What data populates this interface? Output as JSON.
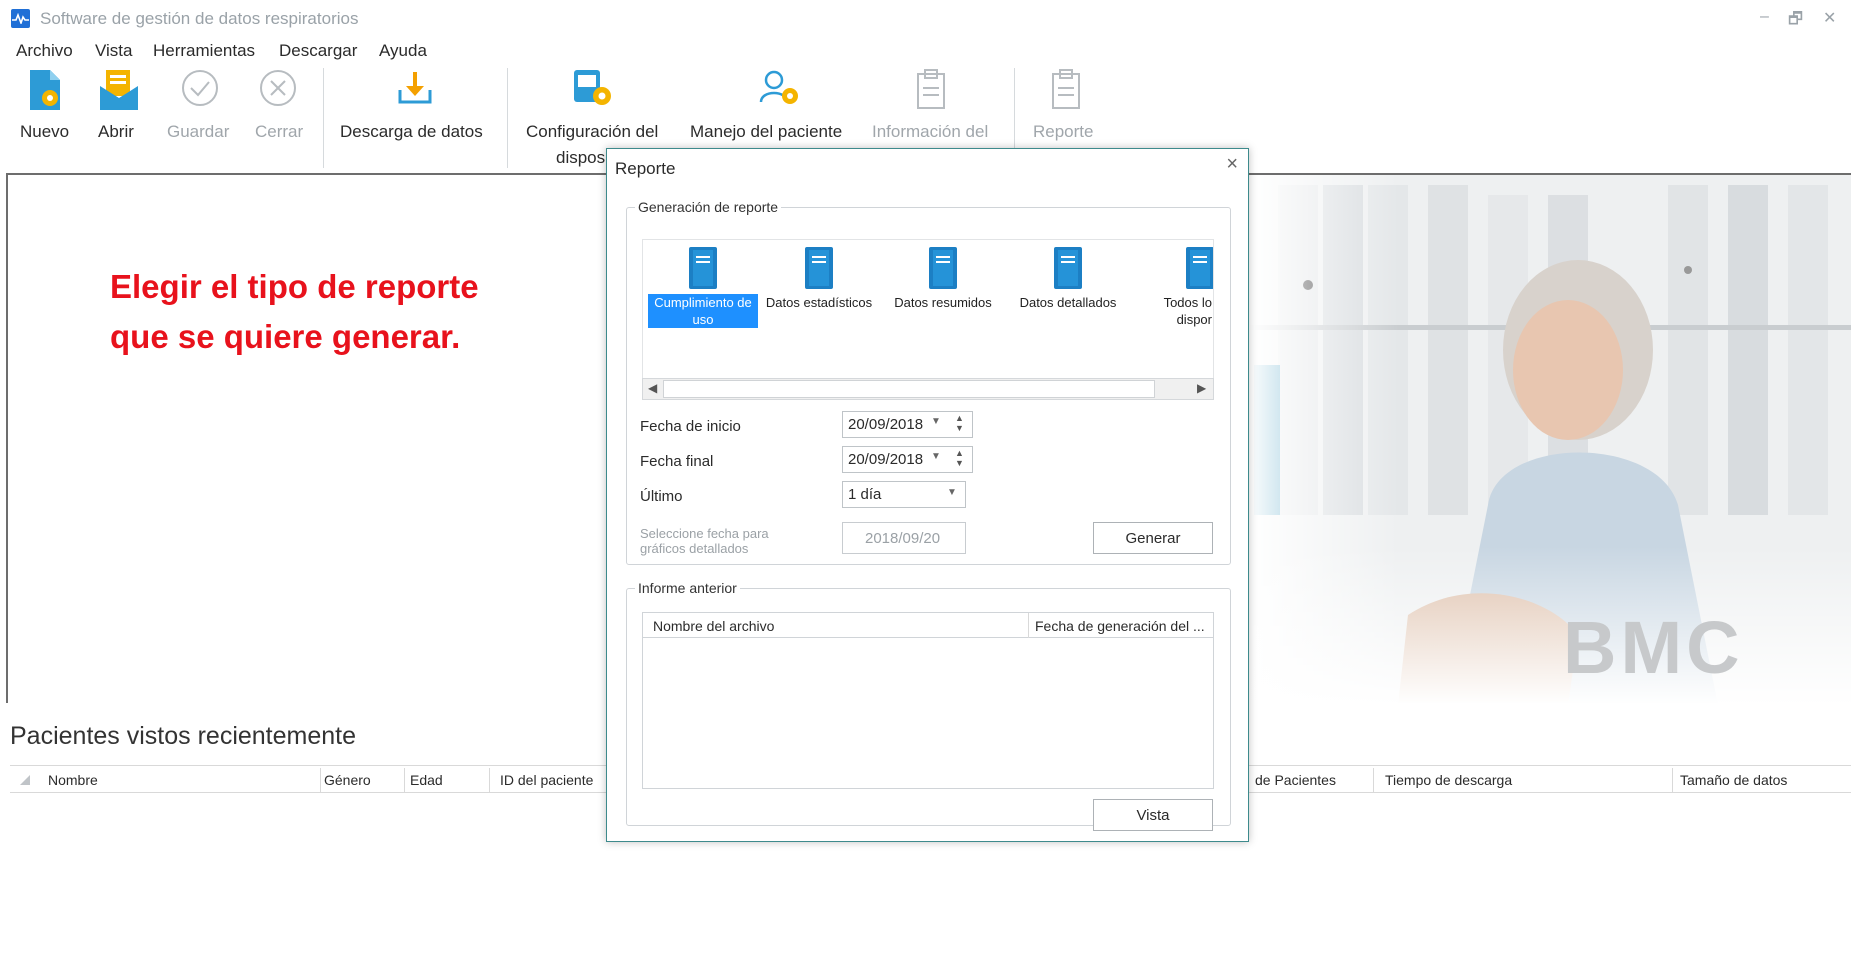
{
  "window": {
    "title": "Software de gestión de datos respiratorios",
    "minimize": "–",
    "restore": "🗗",
    "close": "✕"
  },
  "menu": [
    "Archivo",
    "Vista",
    "Herramientas",
    "Descargar",
    "Ayuda"
  ],
  "toolbar": {
    "nuevo": "Nuevo",
    "abrir": "Abrir",
    "guardar": "Guardar",
    "cerrar": "Cerrar",
    "descarga": "Descarga de datos",
    "config_line1": "Configuración del",
    "config_line2": "dispos",
    "manejo": "Manejo del paciente",
    "informacion": "Información del",
    "reporte": "Reporte"
  },
  "instruction": {
    "line1": "Elegir el tipo de reporte",
    "line2": "que se quiere generar."
  },
  "logo": "BMC",
  "recent": {
    "title": "Pacientes vistos recientemente",
    "columns": [
      "Nombre",
      "Género",
      "Edad",
      "ID del paciente",
      "de Pacientes",
      "Tiempo de descarga",
      "Tamaño de datos"
    ]
  },
  "dialog": {
    "title": "Reporte",
    "close": "×",
    "generation_group": "Generación de reporte",
    "report_types": [
      {
        "label": "Cumplimiento de uso",
        "selected": true
      },
      {
        "label": "Datos estadísticos",
        "selected": false
      },
      {
        "label": "Datos resumidos",
        "selected": false
      },
      {
        "label": "Datos detallados",
        "selected": false
      },
      {
        "label": "Todos lo dispor",
        "selected": false
      }
    ],
    "fecha_inicio_label": "Fecha de inicio",
    "fecha_inicio": "20/09/2018",
    "fecha_final_label": "Fecha final",
    "fecha_final": "20/09/2018",
    "ultimo_label": "Último",
    "ultimo": "1 día",
    "seleccione_line1": "Seleccione fecha para",
    "seleccione_line2": "gráficos detallados",
    "graph_date": "2018/09/20",
    "generar": "Generar",
    "previous_group": "Informe anterior",
    "file_columns": [
      "Nombre del archivo",
      "Fecha de generación del ..."
    ],
    "vista": "Vista"
  },
  "colors": {
    "accent": "#1e90ff",
    "instruction": "#e8121c",
    "dialog_border": "#3d8a8c"
  }
}
